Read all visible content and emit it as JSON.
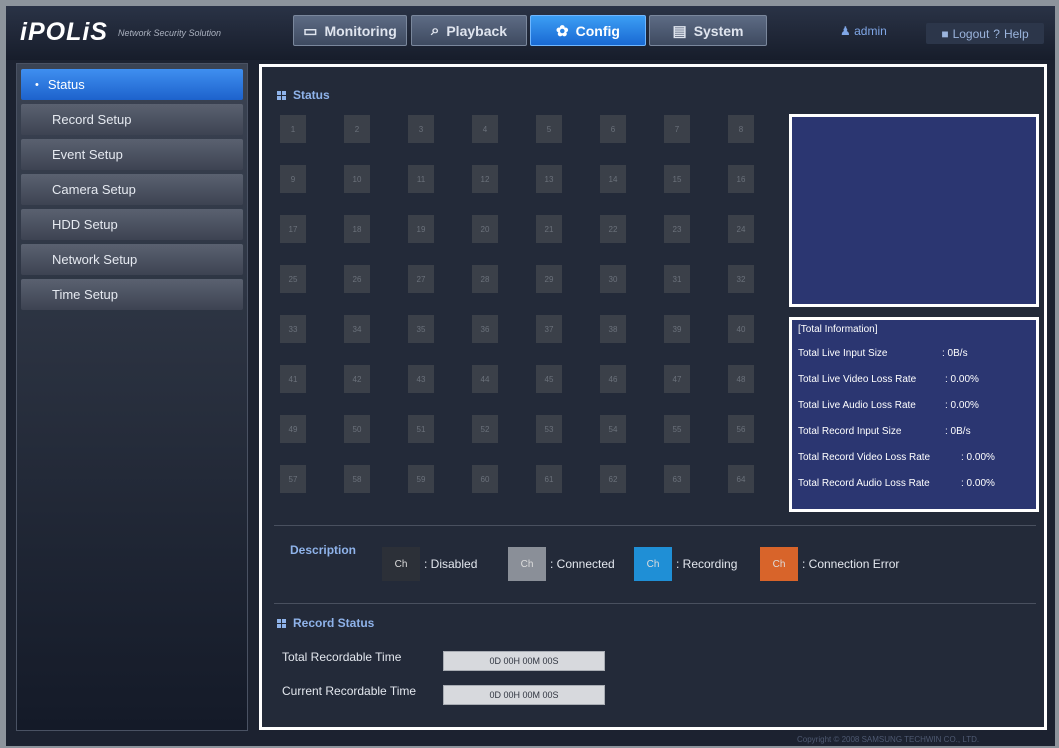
{
  "header": {
    "logo": "iPOLiS",
    "logo_subtitle": "Network Security Solution",
    "tabs": [
      {
        "label": "Monitoring",
        "icon": "monitor-icon",
        "active": false
      },
      {
        "label": "Playback",
        "icon": "magnifier-icon",
        "active": false
      },
      {
        "label": "Config",
        "icon": "gear-icon",
        "active": true
      },
      {
        "label": "System",
        "icon": "document-icon",
        "active": false
      }
    ],
    "user": "admin",
    "logout_label": "Logout",
    "help_label": "Help"
  },
  "sidebar": {
    "items": [
      {
        "label": "Status",
        "active": true
      },
      {
        "label": "Record Setup"
      },
      {
        "label": "Event Setup"
      },
      {
        "label": "Camera Setup"
      },
      {
        "label": "HDD Setup"
      },
      {
        "label": "Network Setup"
      },
      {
        "label": "Time Setup"
      }
    ]
  },
  "status": {
    "title": "Status",
    "channels": [
      "1",
      "2",
      "3",
      "4",
      "5",
      "6",
      "7",
      "8",
      "9",
      "10",
      "11",
      "12",
      "13",
      "14",
      "15",
      "16",
      "17",
      "18",
      "19",
      "20",
      "21",
      "22",
      "23",
      "24",
      "25",
      "26",
      "27",
      "28",
      "29",
      "30",
      "31",
      "32",
      "33",
      "34",
      "35",
      "36",
      "37",
      "38",
      "39",
      "40",
      "41",
      "42",
      "43",
      "44",
      "45",
      "46",
      "47",
      "48",
      "49",
      "50",
      "51",
      "52",
      "53",
      "54",
      "55",
      "56",
      "57",
      "58",
      "59",
      "60",
      "61",
      "62",
      "63",
      "64"
    ],
    "channel_color": "#3b4049"
  },
  "total_info": {
    "title": "[Total Information]",
    "rows": [
      {
        "label": "Total Live Input Size",
        "value": ": 0B/s"
      },
      {
        "label": "Total Live Video Loss Rate",
        "value": ": 0.00%"
      },
      {
        "label": "Total Live Audio Loss Rate",
        "value": ": 0.00%"
      },
      {
        "label": "Total Record Input Size",
        "value": ": 0B/s"
      },
      {
        "label": "Total Record Video Loss Rate",
        "value": ": 0.00%"
      },
      {
        "label": "Total Record Audio Loss Rate",
        "value": ": 0.00%"
      }
    ]
  },
  "description": {
    "label": "Description",
    "items": [
      {
        "swatch_text": "Ch",
        "text": ": Disabled",
        "color": "#2c3038"
      },
      {
        "swatch_text": "Ch",
        "text": ": Connected",
        "color": "#8a8f98"
      },
      {
        "swatch_text": "Ch",
        "text": ": Recording",
        "color": "#1f8fd6"
      },
      {
        "swatch_text": "Ch",
        "text": ": Connection Error",
        "color": "#d8642a"
      }
    ]
  },
  "record_status": {
    "title": "Record Status",
    "rows": [
      {
        "label": "Total Recordable Time",
        "value": "0D 00H 00M 00S"
      },
      {
        "label": "Current Recordable Time",
        "value": "0D 00H 00M 00S"
      }
    ]
  },
  "footer": {
    "copyright": "Copyright © 2008 SAMSUNG TECHWIN CO., LTD."
  }
}
